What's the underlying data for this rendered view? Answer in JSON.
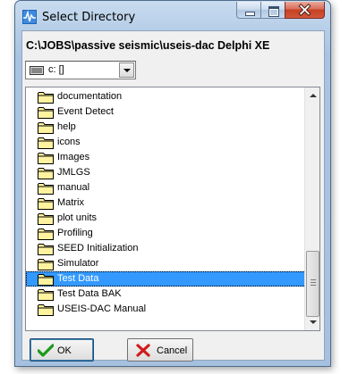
{
  "window": {
    "title": "Select Directory",
    "path": "C:\\JOBS\\passive seismic\\useis-dac Delphi XE"
  },
  "drive": {
    "value": "c: []"
  },
  "directories": [
    {
      "label": "documentation",
      "selected": false
    },
    {
      "label": "Event Detect",
      "selected": false
    },
    {
      "label": "help",
      "selected": false
    },
    {
      "label": "icons",
      "selected": false
    },
    {
      "label": "Images",
      "selected": false
    },
    {
      "label": "JMLGS",
      "selected": false
    },
    {
      "label": "manual",
      "selected": false
    },
    {
      "label": "Matrix",
      "selected": false
    },
    {
      "label": "plot units",
      "selected": false
    },
    {
      "label": "Profiling",
      "selected": false
    },
    {
      "label": "SEED Initialization",
      "selected": false
    },
    {
      "label": "Simulator",
      "selected": false
    },
    {
      "label": "Test Data",
      "selected": true
    },
    {
      "label": "Test Data BAK",
      "selected": false
    },
    {
      "label": "USEIS-DAC Manual",
      "selected": false
    }
  ],
  "buttons": {
    "ok": "OK",
    "cancel": "Cancel"
  },
  "icons": {
    "app": "app-pulse-icon",
    "drive": "hard-drive-icon",
    "folder": "folder-icon",
    "ok": "checkmark-icon",
    "cancel": "red-x-icon"
  },
  "colors": {
    "selection": "#3399ff",
    "folder_fill": "#fff3a0",
    "ok_check": "#1a9a1a",
    "cancel_x": "#d21a1a"
  }
}
